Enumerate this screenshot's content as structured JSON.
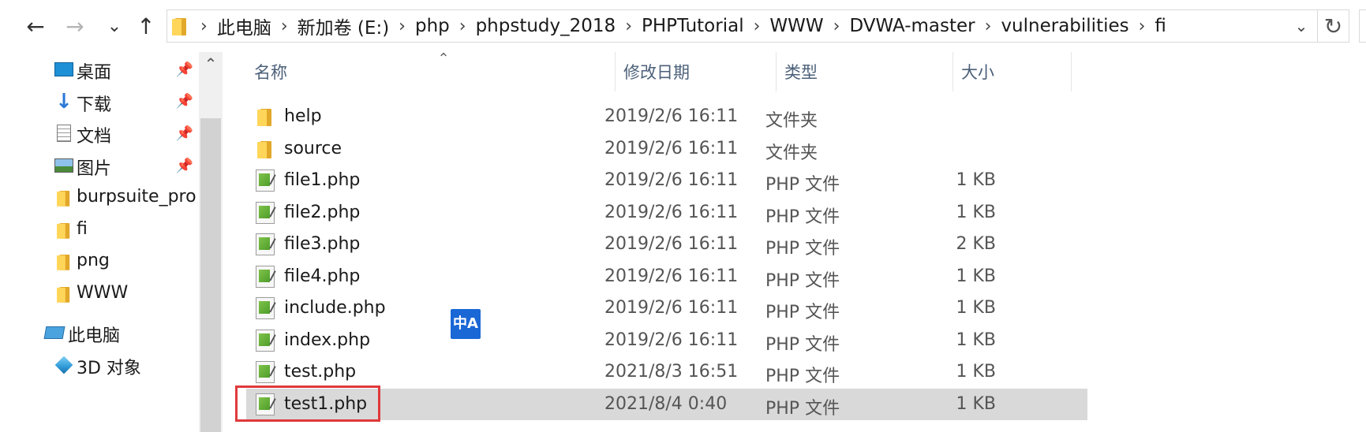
{
  "toolbar": {
    "back_icon": "arrow-left-icon",
    "forward_icon": "arrow-right-icon",
    "recent_icon": "chevron-down-icon",
    "up_icon": "arrow-up-icon",
    "back_glyph": "←",
    "forward_glyph": "→",
    "recent_glyph": "⌄",
    "up_glyph": "↑",
    "refresh_glyph": "↻",
    "dropdown_glyph": "⌄"
  },
  "address_bar": {
    "separator": "›",
    "breadcrumbs": [
      "此电脑",
      "新加卷 (E:)",
      "php",
      "phpstudy_2018",
      "PHPTutorial",
      "WWW",
      "DVWA-master",
      "vulnerabilities",
      "fi"
    ]
  },
  "nav_pane": {
    "quick_access": [
      {
        "label": "桌面",
        "icon": "desktop-icon",
        "pinned": true
      },
      {
        "label": "下载",
        "icon": "download-icon",
        "pinned": true
      },
      {
        "label": "文档",
        "icon": "document-icon",
        "pinned": true
      },
      {
        "label": "图片",
        "icon": "pictures-icon",
        "pinned": true
      },
      {
        "label": "burpsuite_pro",
        "icon": "folder-icon",
        "pinned": false
      },
      {
        "label": "fi",
        "icon": "folder-icon",
        "pinned": false
      },
      {
        "label": "png",
        "icon": "folder-icon",
        "pinned": false
      },
      {
        "label": "WWW",
        "icon": "folder-icon",
        "pinned": false
      }
    ],
    "this_pc": {
      "label": "此电脑",
      "icon": "computer-icon"
    },
    "objects_3d": {
      "label": "3D 对象",
      "icon": "cube-3d-icon"
    },
    "pin_glyph": "📌",
    "scroll_up_glyph": "⌃"
  },
  "file_list": {
    "columns": {
      "name": "名称",
      "modified": "修改日期",
      "type": "类型",
      "size": "大小"
    },
    "sort_glyph": "⌃",
    "rows": [
      {
        "name": "help",
        "modified": "2019/2/6 16:11",
        "type": "文件夹",
        "size": "",
        "kind": "folder"
      },
      {
        "name": "source",
        "modified": "2019/2/6 16:11",
        "type": "文件夹",
        "size": "",
        "kind": "folder"
      },
      {
        "name": "file1.php",
        "modified": "2019/2/6 16:11",
        "type": "PHP 文件",
        "size": "1 KB",
        "kind": "php"
      },
      {
        "name": "file2.php",
        "modified": "2019/2/6 16:11",
        "type": "PHP 文件",
        "size": "1 KB",
        "kind": "php"
      },
      {
        "name": "file3.php",
        "modified": "2019/2/6 16:11",
        "type": "PHP 文件",
        "size": "2 KB",
        "kind": "php"
      },
      {
        "name": "file4.php",
        "modified": "2019/2/6 16:11",
        "type": "PHP 文件",
        "size": "1 KB",
        "kind": "php"
      },
      {
        "name": "include.php",
        "modified": "2019/2/6 16:11",
        "type": "PHP 文件",
        "size": "1 KB",
        "kind": "php"
      },
      {
        "name": "index.php",
        "modified": "2019/2/6 16:11",
        "type": "PHP 文件",
        "size": "1 KB",
        "kind": "php"
      },
      {
        "name": "test.php",
        "modified": "2021/8/3 16:51",
        "type": "PHP 文件",
        "size": "1 KB",
        "kind": "php"
      },
      {
        "name": "test1.php",
        "modified": "2021/8/4 0:40",
        "type": "PHP 文件",
        "size": "1 KB",
        "kind": "php",
        "selected": true
      }
    ]
  },
  "ime_badge": {
    "label": "中A",
    "icon": "translate-icon"
  },
  "colors": {
    "selection": "#d9d9d9",
    "highlight_border": "#e0393b",
    "header_text": "#4c607a",
    "ime_badge_bg": "#1a67d6"
  }
}
